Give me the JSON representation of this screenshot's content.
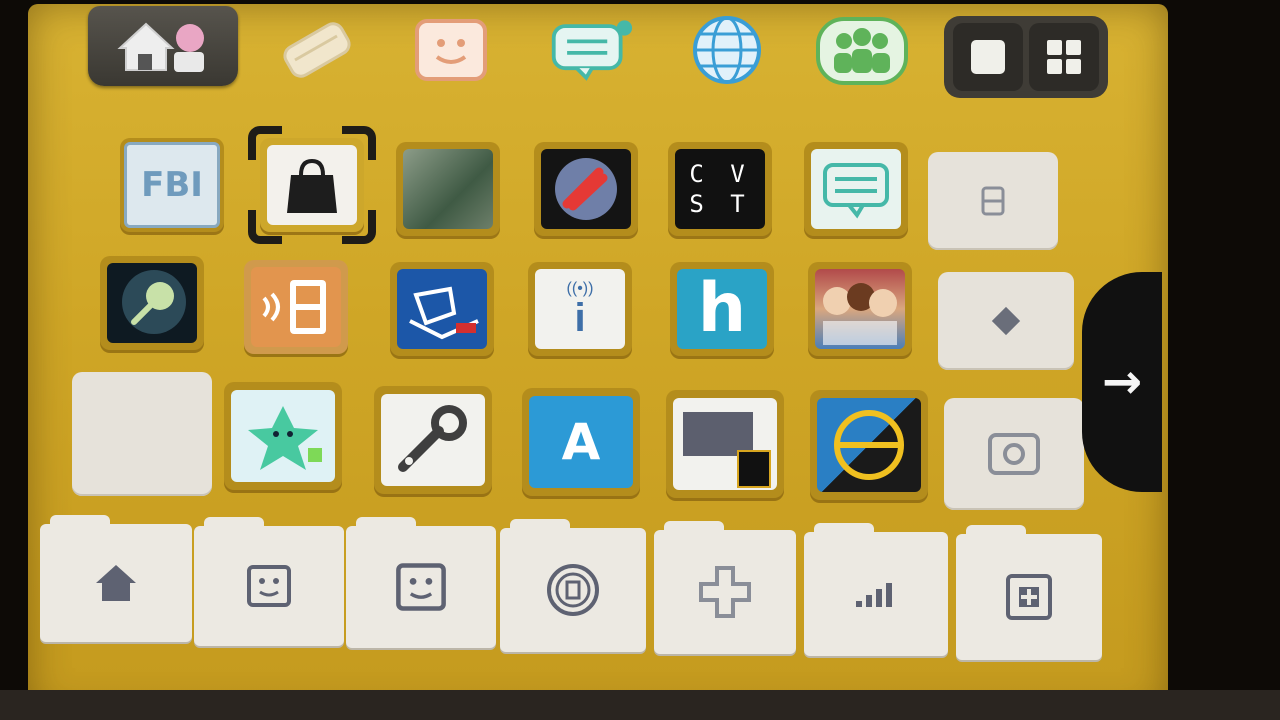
{
  "top_bar": {
    "home_settings": {
      "icon": "home-settings-icon"
    },
    "buttons": [
      {
        "icon": "pencil-icon",
        "color": "#d9c9a0"
      },
      {
        "icon": "mii-face-icon",
        "color": "#e39d78"
      },
      {
        "icon": "notification-speech-icon",
        "color": "#45b8a8"
      },
      {
        "icon": "globe-icon",
        "color": "#3a9ed6"
      },
      {
        "icon": "friends-icon",
        "color": "#5fb35a"
      }
    ],
    "layout_toggle": {
      "options": [
        "single-view-icon",
        "grid-view-icon"
      ]
    }
  },
  "grid": {
    "row1": [
      {
        "name": "FBI",
        "label": "FBI"
      },
      {
        "name": "shop",
        "label": ""
      },
      {
        "name": "forest-app",
        "label": ""
      },
      {
        "name": "rocket-app",
        "label": ""
      },
      {
        "name": "cvst",
        "label_lines": [
          "C V",
          "S T"
        ]
      },
      {
        "name": "chat-app",
        "label": ""
      }
    ],
    "row2": [
      {
        "name": "lens-app",
        "label": ""
      },
      {
        "name": "ds-connection-app",
        "label": ""
      },
      {
        "name": "drive-app",
        "label": ""
      },
      {
        "name": "info-app",
        "label": "i"
      },
      {
        "name": "h-app",
        "label": "h"
      },
      {
        "name": "characters-app",
        "label": ""
      }
    ],
    "row3": [
      {
        "name": "green-star-app",
        "label": ""
      },
      {
        "name": "wrench-app",
        "label": ""
      },
      {
        "name": "a-app",
        "label": "A"
      },
      {
        "name": "sd-app",
        "label": ""
      },
      {
        "name": "ball-app",
        "label": ""
      }
    ]
  },
  "folders": [
    {
      "icon": "home-icon"
    },
    {
      "icon": "mii-face-icon"
    },
    {
      "icon": "mii-face-icon"
    },
    {
      "icon": "disc-icon"
    },
    {
      "icon": "dpad-icon"
    },
    {
      "icon": "signal-bars-icon"
    },
    {
      "icon": "plus-box-icon"
    }
  ],
  "navigation": {
    "next_page": "→"
  }
}
